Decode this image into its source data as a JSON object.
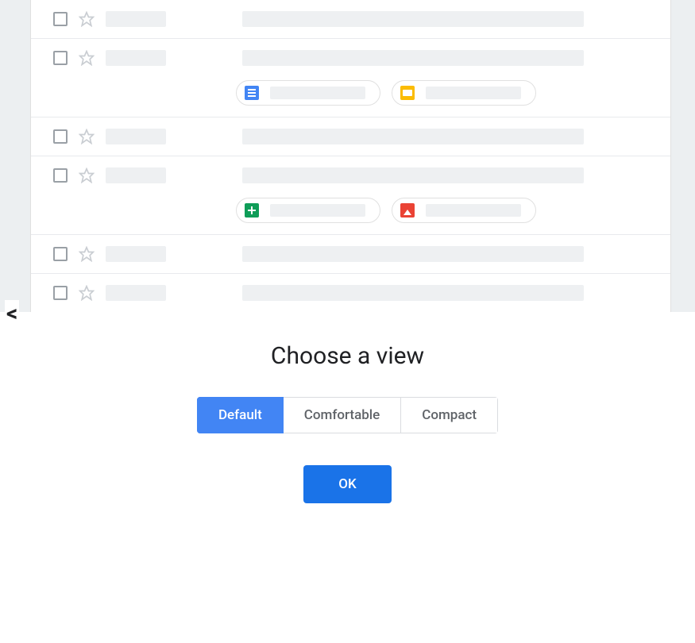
{
  "preview": {
    "rows": [
      {
        "attachments": []
      },
      {
        "attachments": [
          {
            "type": "docs"
          },
          {
            "type": "slides"
          }
        ]
      },
      {
        "attachments": []
      },
      {
        "attachments": [
          {
            "type": "sheets"
          },
          {
            "type": "image"
          }
        ]
      },
      {
        "attachments": []
      },
      {
        "attachments": []
      }
    ]
  },
  "chooser": {
    "title": "Choose a view",
    "options": {
      "default": "Default",
      "comfortable": "Comfortable",
      "compact": "Compact"
    },
    "selected": "default",
    "ok_label": "OK"
  }
}
